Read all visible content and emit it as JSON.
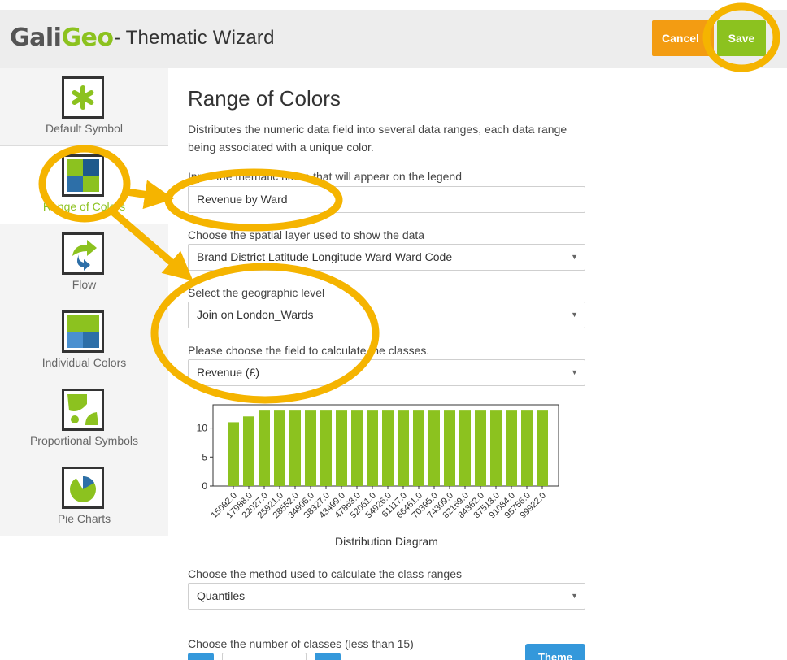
{
  "header": {
    "logo_part1": "Gali",
    "logo_part2": "Geo",
    "title": "- Thematic Wizard",
    "cancel_label": "Cancel",
    "save_label": "Save"
  },
  "sidebar": {
    "items": [
      {
        "label": "Default Symbol",
        "icon": "asterisk-icon"
      },
      {
        "label": "Range of Colors",
        "icon": "color-grid-icon",
        "active": true
      },
      {
        "label": "Flow",
        "icon": "flow-arrow-icon"
      },
      {
        "label": "Individual Colors",
        "icon": "color-squares-icon"
      },
      {
        "label": "Proportional Symbols",
        "icon": "proportional-symbols-icon"
      },
      {
        "label": "Pie Charts",
        "icon": "pie-chart-icon"
      }
    ]
  },
  "main": {
    "title": "Range of Colors",
    "description": "Distributes the numeric data field into several data ranges, each data range being associated with a unique color.",
    "name_label": "Input the thematic name that will appear on the legend",
    "name_value": "Revenue by Ward",
    "layer_label": "Choose the spatial layer used to show the data",
    "layer_value": "Brand District Latitude Longitude Ward Ward Code",
    "geo_label": "Select the geographic level",
    "geo_value": "Join on London_Wards",
    "field_label": "Please choose the field to calculate the classes.",
    "field_value": "Revenue (£)",
    "method_label": "Choose the method used to calculate the class ranges",
    "method_value": "Quantiles",
    "classes_label": "Choose the number of classes (less than 15)",
    "theme_button": "Theme"
  },
  "chart_data": {
    "type": "bar",
    "title": "Distribution Diagram",
    "categories": [
      "15092.0",
      "17988.0",
      "22027.0",
      "25921.0",
      "28552.0",
      "34906.0",
      "38327.0",
      "43499.0",
      "47863.0",
      "52061.0",
      "54926.0",
      "61117.0",
      "66461.0",
      "70395.0",
      "74309.0",
      "82169.0",
      "84362.0",
      "87513.0",
      "91084.0",
      "95756.0",
      "99922.0"
    ],
    "values": [
      11,
      12,
      13,
      13,
      13,
      13,
      13,
      13,
      13,
      13,
      13,
      13,
      13,
      13,
      13,
      13,
      13,
      13,
      13,
      13,
      13
    ],
    "yticks": [
      "0",
      "5",
      "10"
    ],
    "ylim": [
      0,
      14
    ],
    "bar_color": "#8cc21f"
  },
  "colors": {
    "accent_green": "#8cc21f",
    "cancel_orange": "#f39c12",
    "annotation_yellow": "#f5b400",
    "blue": "#3498db"
  }
}
